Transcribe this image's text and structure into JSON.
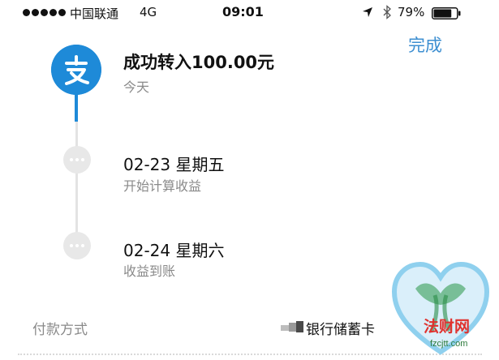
{
  "status_bar": {
    "carrier": "中国联通",
    "network": "4G",
    "time": "09:01",
    "battery_percent": "79%",
    "battery_level": 0.79
  },
  "header": {
    "done_label": "完成"
  },
  "timeline": {
    "steps": [
      {
        "title": "成功转入100.00元",
        "subtitle": "今天"
      },
      {
        "title": "02-23 星期五",
        "subtitle": "开始计算收益"
      },
      {
        "title": "02-24 星期六",
        "subtitle": "收益到账"
      }
    ]
  },
  "payment": {
    "label": "付款方式",
    "value": "银行储蓄卡"
  },
  "watermark": {
    "text": "法财网",
    "url": "fzcjtt.com"
  },
  "colors": {
    "accent": "#1e8ad8",
    "link": "#3d8fd1",
    "muted_text": "#8a8a8a",
    "watermark_red": "#e0322e",
    "watermark_green": "#2c7a3c"
  },
  "icons": {
    "app_logo": "alipay-logo-icon",
    "location": "location-arrow-icon",
    "bluetooth": "bluetooth-icon",
    "battery": "battery-icon"
  }
}
